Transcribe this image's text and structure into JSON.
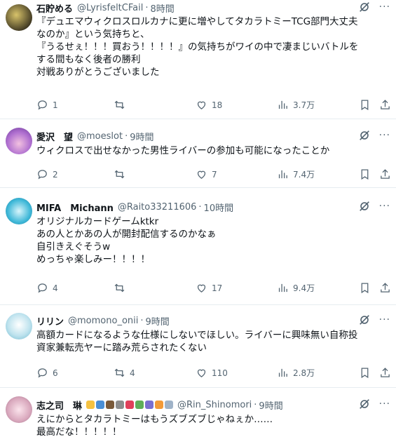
{
  "posts": [
    {
      "name": "石貯める",
      "handle": "@LyrisfeltCFail",
      "time": "8時間",
      "text": "『デュエマウィクロスロルカナに更に増やしてタカラトミーTCG部門大丈夫\nなのか』という気持ちと、\n『うるせぇ！！！買おう！！！！』の気持ちがワイの中で凄まじいバトルを\nする間もなく後者の勝利\n対戦ありがとうございました",
      "replies": "1",
      "reposts": "",
      "likes": "18",
      "views": "3.7万"
    },
    {
      "name": "愛沢　望",
      "handle": "@moeslot",
      "time": "9時間",
      "text": "ウィクロスで出せなかった男性ライバーの参加も可能になったことか",
      "replies": "2",
      "reposts": "",
      "likes": "7",
      "views": "7.4万"
    },
    {
      "name": "MIFA　Michann",
      "handle": "@Raito33211606",
      "time": "10時間",
      "text": "オリジナルカードゲームktkr\nあの人とかあの人が開封配信するのかなぁ\n自引きえぐそうw\nめっちゃ楽しみー！！！！",
      "replies": "4",
      "reposts": "",
      "likes": "17",
      "views": "9.4万"
    },
    {
      "name": "リリン",
      "handle": "@momono_onii",
      "time": "9時間",
      "text": "高額カードになるような仕様にしないでほしい。ライバーに興味無い自称投\n資家兼転売ヤーに踏み荒らされたくない",
      "replies": "6",
      "reposts": "4",
      "likes": "110",
      "views": "2.8万"
    },
    {
      "name": "志之司　琳",
      "handle": "@Rin_Shinomori",
      "time": "9時間",
      "text": "えにからとタカラトミーはもうズブズブじゃねぇか……\n最高だな！！！！！"
    }
  ],
  "colors": {
    "text": "#0f1419",
    "muted": "#536471",
    "divider": "#e6ecf0"
  }
}
